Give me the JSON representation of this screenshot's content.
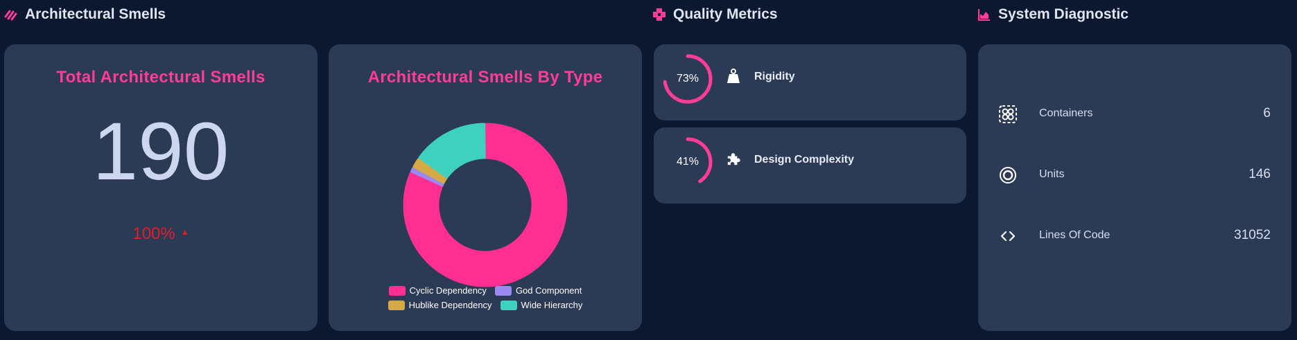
{
  "sections": {
    "architectural_smells": "Architectural Smells",
    "quality_metrics": "Quality Metrics",
    "system_diagnostic": "System Diagnostic"
  },
  "total_card": {
    "heading": "Total Architectural Smells",
    "value": "190",
    "change": "100%",
    "change_direction": "up"
  },
  "chart_card": {
    "heading": "Architectural Smells By Type"
  },
  "chart_data": {
    "type": "pie",
    "style": "donut",
    "categories": [
      "Cyclic Dependency",
      "God Component",
      "Hublike Dependency",
      "Wide Hierarchy"
    ],
    "values": [
      155,
      2,
      4,
      29
    ],
    "colors": [
      "#ff2f92",
      "#9b8af0",
      "#d5aa45",
      "#3fd1c0"
    ],
    "legend_position": "bottom"
  },
  "quality_metrics": [
    {
      "label": "Rigidity",
      "percent_text": "73%",
      "value": 0.73,
      "icon": "weight-icon"
    },
    {
      "label": "Design Complexity",
      "percent_text": "41%",
      "value": 0.41,
      "icon": "puzzle-icon"
    }
  ],
  "diagnostic": [
    {
      "label": "Containers",
      "value": "6",
      "icon": "containers-icon"
    },
    {
      "label": "Units",
      "value": "146",
      "icon": "units-icon"
    },
    {
      "label": "Lines Of Code",
      "value": "31052",
      "icon": "code-icon"
    }
  ],
  "colors": {
    "background": "#0c1830",
    "card": "#2b3a55",
    "accent": "#ff3d96",
    "negative": "#e51d2a"
  }
}
